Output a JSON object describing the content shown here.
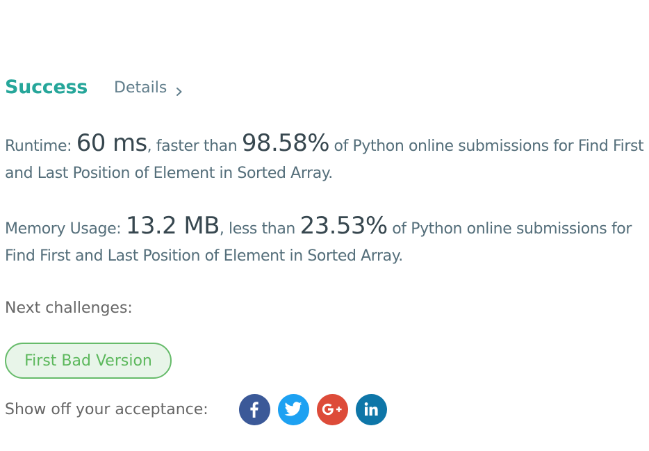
{
  "header": {
    "status": "Success",
    "details_label": "Details"
  },
  "runtime": {
    "prefix": "Runtime: ",
    "value": "60 ms",
    "middle": ", faster than ",
    "percent": "98.58%",
    "suffix": " of Python online submissions for Find First and Last Position of Element in Sorted Array."
  },
  "memory": {
    "prefix": "Memory Usage: ",
    "value": "13.2 MB",
    "middle": ", less than ",
    "percent": "23.53%",
    "suffix": " of Python online submissions for Find First and Last Position of Element in Sorted Array."
  },
  "next": {
    "label": "Next challenges:",
    "challenge": "First Bad Version"
  },
  "share": {
    "label": "Show off your acceptance:",
    "networks": [
      {
        "name": "facebook",
        "color": "#3b5998"
      },
      {
        "name": "twitter",
        "color": "#1da1f2"
      },
      {
        "name": "google-plus",
        "color": "#dd4b39"
      },
      {
        "name": "linkedin",
        "color": "#0e76a8"
      }
    ]
  }
}
